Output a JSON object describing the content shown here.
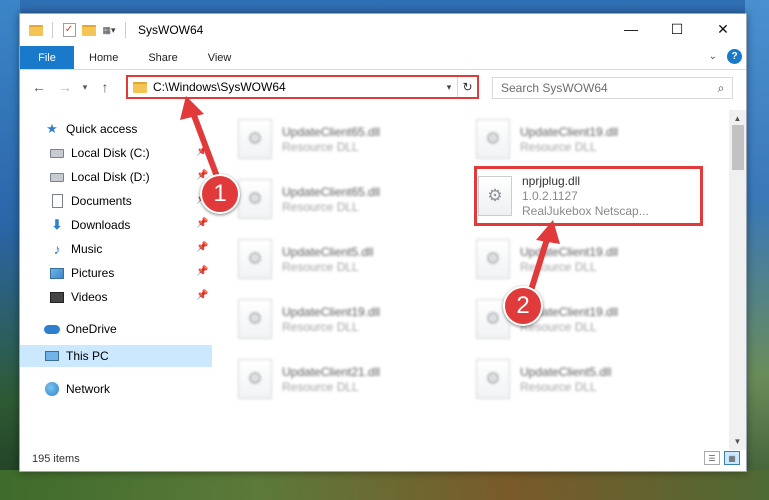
{
  "window": {
    "title": "SysWOW64",
    "controls": [
      "minimize",
      "maximize",
      "close"
    ]
  },
  "ribbon": {
    "tabs": [
      "File",
      "Home",
      "Share",
      "View"
    ],
    "help_label": "?"
  },
  "address": {
    "path": "C:\\Windows\\SysWOW64"
  },
  "search": {
    "placeholder": "Search SysWOW64"
  },
  "sidebar": {
    "items": [
      {
        "label": "Quick access",
        "icon": "star-icon"
      },
      {
        "label": "Local Disk (C:)",
        "icon": "drive-icon",
        "pinned": true
      },
      {
        "label": "Local Disk (D:)",
        "icon": "drive-icon",
        "pinned": true
      },
      {
        "label": "Documents",
        "icon": "documents-icon",
        "pinned": true
      },
      {
        "label": "Downloads",
        "icon": "downloads-icon",
        "pinned": true
      },
      {
        "label": "Music",
        "icon": "music-icon",
        "pinned": true
      },
      {
        "label": "Pictures",
        "icon": "pictures-icon",
        "pinned": true
      },
      {
        "label": "Videos",
        "icon": "videos-icon",
        "pinned": true
      },
      {
        "label": "OneDrive",
        "icon": "cloud-icon"
      },
      {
        "label": "This PC",
        "icon": "pc-icon",
        "selected": true
      },
      {
        "label": "Network",
        "icon": "network-icon"
      }
    ]
  },
  "files": [
    {
      "name": "UpdateClient65.dll",
      "type": "Resource DLL"
    },
    {
      "name": "UpdateClient19.dll",
      "type": "Resource DLL"
    },
    {
      "name": "UpdateClient65.dll",
      "type": "Resource DLL"
    },
    {
      "name": "nprjplug.dll",
      "version": "1.0.2.1127",
      "description": "RealJukebox Netscap...",
      "highlighted": true
    },
    {
      "name": "UpdateClient5.dll",
      "type": "Resource DLL"
    },
    {
      "name": "UpdateClient19.dll",
      "type": "Resource DLL"
    },
    {
      "name": "UpdateClient19.dll",
      "type": "Resource DLL"
    },
    {
      "name": "UpdateClient19.dll",
      "type": "Resource DLL"
    },
    {
      "name": "UpdateClient21.dll",
      "type": "Resource DLL"
    },
    {
      "name": "UpdateClient5.dll",
      "type": "Resource DLL"
    }
  ],
  "status": {
    "item_count": "195 items"
  },
  "annotations": {
    "badge1": "1",
    "badge2": "2",
    "color": "#e03a3a"
  },
  "colors": {
    "accent": "#1979ca",
    "selection": "#cce8ff",
    "highlight_red": "#e03a3a"
  }
}
